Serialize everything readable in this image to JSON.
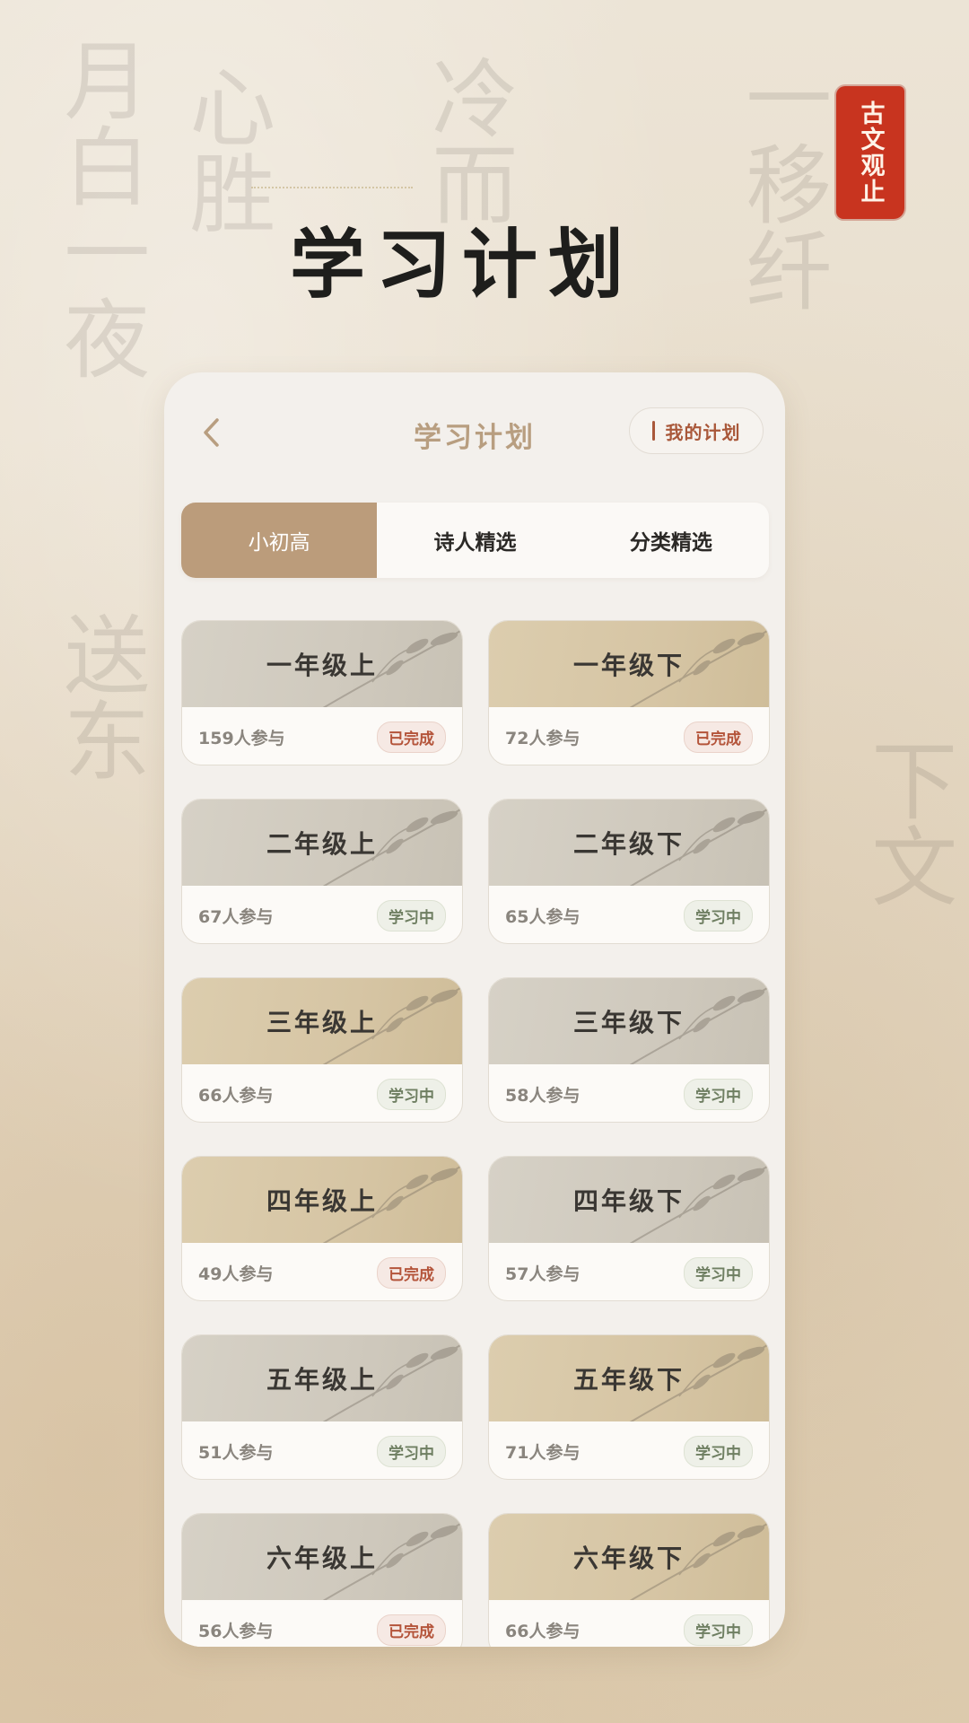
{
  "app": {
    "seal_text": "古文观止",
    "page_heading": "学习计划"
  },
  "header": {
    "back_icon": "chevron-left-icon",
    "title": "学习计划",
    "my_plan_label": "我的计划"
  },
  "tabs": [
    {
      "label": "小初高",
      "active": true
    },
    {
      "label": "诗人精选",
      "active": false
    },
    {
      "label": "分类精选",
      "active": false
    }
  ],
  "colors": {
    "accent": "#bb9c7b",
    "done": "#b4543a",
    "learning": "#6f7f62",
    "seal": "#c8341f"
  },
  "cards": [
    {
      "title": "一年级上",
      "count": "159人参与",
      "status": "已完成",
      "state": "done",
      "tone": "grey"
    },
    {
      "title": "一年级下",
      "count": "72人参与",
      "status": "已完成",
      "state": "done",
      "tone": "tan"
    },
    {
      "title": "二年级上",
      "count": "67人参与",
      "status": "学习中",
      "state": "learning",
      "tone": "grey"
    },
    {
      "title": "二年级下",
      "count": "65人参与",
      "status": "学习中",
      "state": "learning",
      "tone": "grey"
    },
    {
      "title": "三年级上",
      "count": "66人参与",
      "status": "学习中",
      "state": "learning",
      "tone": "tan"
    },
    {
      "title": "三年级下",
      "count": "58人参与",
      "status": "学习中",
      "state": "learning",
      "tone": "grey"
    },
    {
      "title": "四年级上",
      "count": "49人参与",
      "status": "已完成",
      "state": "done",
      "tone": "tan"
    },
    {
      "title": "四年级下",
      "count": "57人参与",
      "status": "学习中",
      "state": "learning",
      "tone": "grey"
    },
    {
      "title": "五年级上",
      "count": "51人参与",
      "status": "学习中",
      "state": "learning",
      "tone": "grey"
    },
    {
      "title": "五年级下",
      "count": "71人参与",
      "status": "学习中",
      "state": "learning",
      "tone": "tan"
    },
    {
      "title": "六年级上",
      "count": "56人参与",
      "status": "已完成",
      "state": "done",
      "tone": "grey"
    },
    {
      "title": "六年级下",
      "count": "66人参与",
      "status": "学习中",
      "state": "learning",
      "tone": "tan"
    }
  ]
}
